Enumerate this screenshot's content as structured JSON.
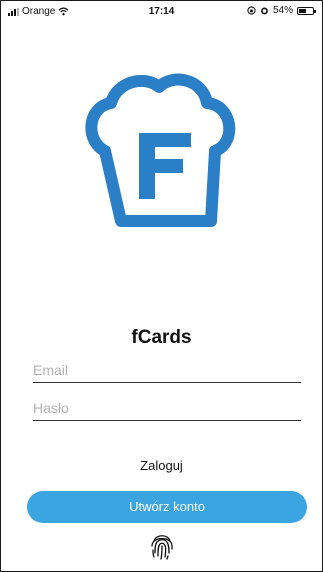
{
  "status_bar": {
    "carrier": "Orange",
    "time": "17:14",
    "battery_percent": "54%",
    "battery_level": 0.54,
    "icons": [
      "signal-icon",
      "wifi-icon",
      "lock-rotation-icon",
      "alarm-icon",
      "battery-icon"
    ]
  },
  "app": {
    "title": "fCards",
    "logo_icon": "chef-hat-f-logo",
    "brand_color": "#2b7fc6",
    "accent_color": "#3ba5e2"
  },
  "form": {
    "email_placeholder": "Email",
    "email_value": "",
    "password_placeholder": "Hasło",
    "password_value": ""
  },
  "actions": {
    "login_label": "Zaloguj",
    "create_account_label": "Utwórz konto",
    "biometric_icon": "fingerprint-icon"
  }
}
